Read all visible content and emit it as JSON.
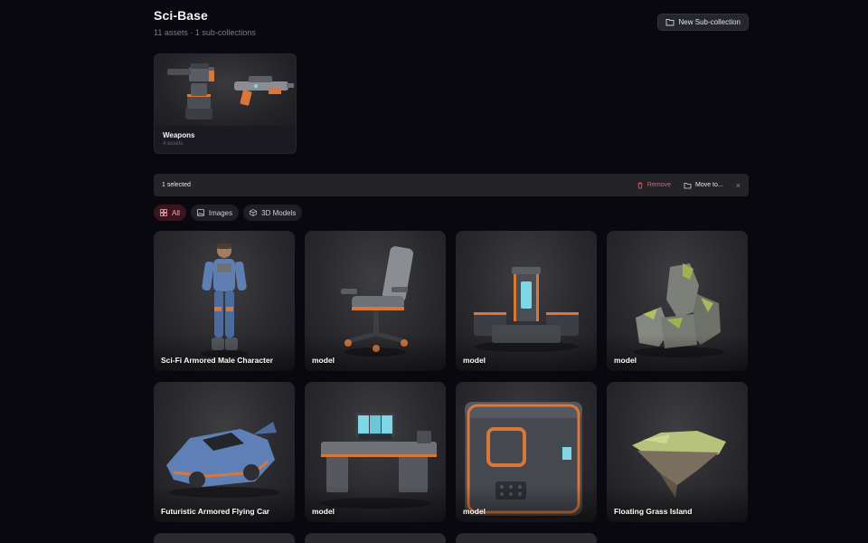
{
  "collection": {
    "title": "Sci-Base",
    "summary": "11 assets · 1 sub-collections",
    "new_subcollection_label": "New Sub-collection"
  },
  "subcollections": [
    {
      "name": "Weapons",
      "count": "4 assets"
    }
  ],
  "selection_bar": {
    "count_label": "1 selected",
    "remove_label": "Remove",
    "move_label": "Move to...",
    "close_glyph": "×"
  },
  "filters": [
    {
      "label": "All",
      "icon": "grid-icon",
      "active": true
    },
    {
      "label": "Images",
      "icon": "image-icon",
      "active": false
    },
    {
      "label": "3D Models",
      "icon": "cube-icon",
      "active": false
    }
  ],
  "assets": [
    {
      "label": "Sci-Fi Armored Male Character",
      "art": "character"
    },
    {
      "label": "model",
      "art": "chair"
    },
    {
      "label": "model",
      "art": "reactor"
    },
    {
      "label": "model",
      "art": "rocks"
    },
    {
      "label": "Futuristic Armored Flying Car",
      "art": "car"
    },
    {
      "label": "model",
      "art": "desk"
    },
    {
      "label": "model",
      "art": "crate"
    },
    {
      "label": "Floating Grass Island",
      "art": "island"
    }
  ],
  "colors": {
    "background": "#09080e",
    "accent_active_chip": "#3a1520",
    "remove": "#ef5b6a"
  }
}
